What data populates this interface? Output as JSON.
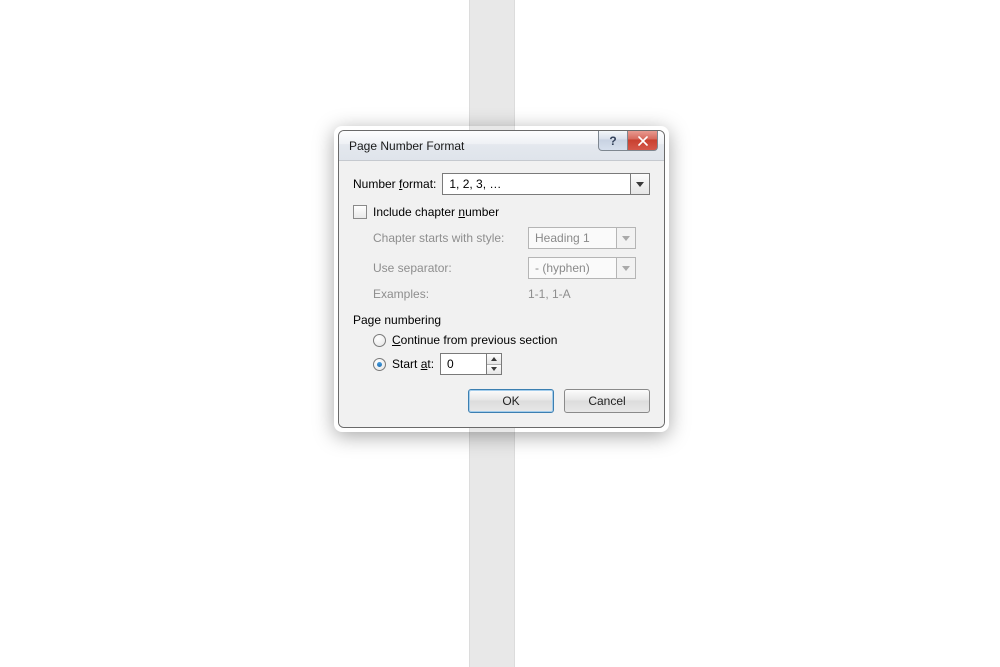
{
  "dialog": {
    "title": "Page Number Format",
    "number_format_label_pre": "Number ",
    "number_format_label_u": "f",
    "number_format_label_post": "ormat:",
    "number_format_value": "1, 2, 3, …",
    "include_chapter_pre": "Include chapter ",
    "include_chapter_u": "n",
    "include_chapter_post": "umber",
    "include_chapter_checked": false,
    "chapter_style_label": "Chapter starts with style:",
    "chapter_style_value": "Heading 1",
    "separator_label": "Use separator:",
    "separator_value": "-   (hyphen)",
    "examples_label": "Examples:",
    "examples_value": "1-1, 1-A",
    "page_numbering_label": "Page numbering",
    "continue_u": "C",
    "continue_post": "ontinue from previous section",
    "start_at_pre": "Start ",
    "start_at_u": "a",
    "start_at_post": "t:",
    "start_at_value": "0",
    "start_at_selected": true,
    "ok_label": "OK",
    "cancel_label": "Cancel"
  }
}
